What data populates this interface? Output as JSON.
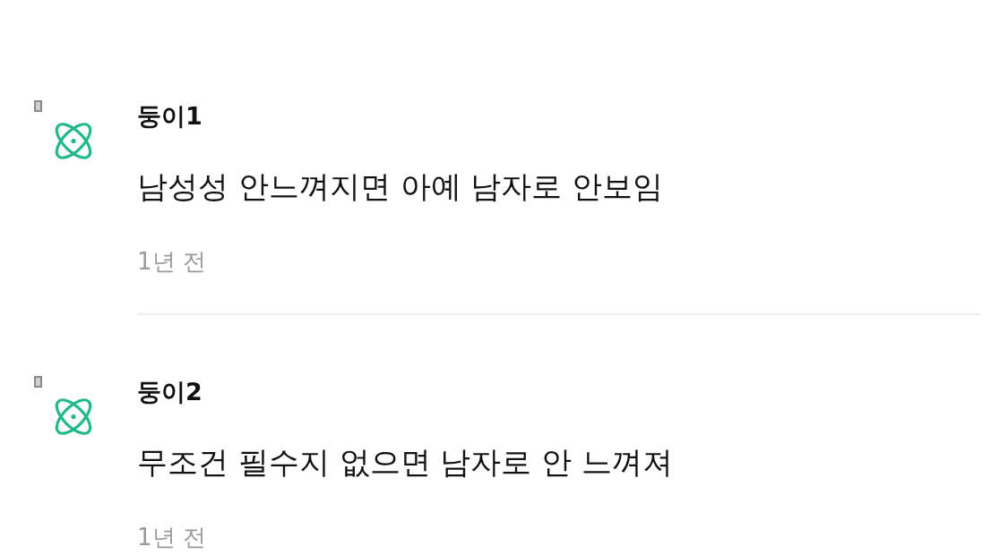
{
  "comments": [
    {
      "author": "둥이1",
      "text": "남성성 안느껴지면 아예 남자로 안보임",
      "time": "1년 전"
    },
    {
      "author": "둥이2",
      "text": "무조건 필수지 없으면 남자로 안 느껴져",
      "time": "1년 전"
    }
  ]
}
